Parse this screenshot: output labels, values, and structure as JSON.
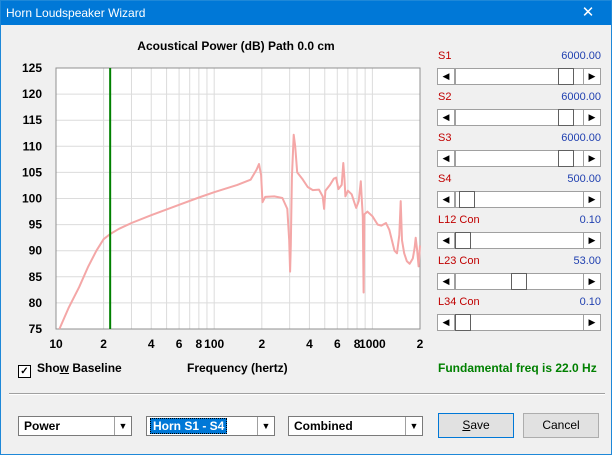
{
  "window": {
    "title": "Horn Loudspeaker Wizard",
    "close_glyph": "✕"
  },
  "chart_data": {
    "type": "line",
    "title": "Acoustical Power (dB)   Path 0.0 cm",
    "xlabel": "Frequency (hertz)",
    "ylabel": "",
    "x_scale": "log",
    "xlim": [
      10,
      2000
    ],
    "ylim": [
      75,
      125
    ],
    "y_ticks": [
      75,
      80,
      85,
      90,
      95,
      100,
      105,
      110,
      115,
      120,
      125
    ],
    "x_tick_labels": [
      {
        "x": 10,
        "label": "10"
      },
      {
        "x": 20,
        "label": "2"
      },
      {
        "x": 40,
        "label": "4"
      },
      {
        "x": 60,
        "label": "6"
      },
      {
        "x": 80,
        "label": "8"
      },
      {
        "x": 100,
        "label": "100"
      },
      {
        "x": 200,
        "label": "2"
      },
      {
        "x": 400,
        "label": "4"
      },
      {
        "x": 600,
        "label": "6"
      },
      {
        "x": 800,
        "label": "8"
      },
      {
        "x": 1000,
        "label": "1000"
      },
      {
        "x": 2000,
        "label": "2"
      }
    ],
    "grid": true,
    "baseline_marker": {
      "x": 22.0,
      "color": "#008000"
    },
    "series": [
      {
        "color": "#f4a7a7",
        "points": [
          [
            10.5,
            75
          ],
          [
            12,
            79
          ],
          [
            14,
            83
          ],
          [
            16,
            87
          ],
          [
            18,
            90
          ],
          [
            20,
            92.2
          ],
          [
            22,
            93.2
          ],
          [
            25,
            94.2
          ],
          [
            30,
            95.3
          ],
          [
            40,
            96.8
          ],
          [
            60,
            98.8
          ],
          [
            80,
            100.2
          ],
          [
            100,
            101.2
          ],
          [
            140,
            102.6
          ],
          [
            170,
            103.6
          ],
          [
            185,
            105.5
          ],
          [
            192,
            106.6
          ],
          [
            198,
            104.5
          ],
          [
            202,
            99.3
          ],
          [
            210,
            100.3
          ],
          [
            240,
            100.4
          ],
          [
            270,
            100.1
          ],
          [
            290,
            98
          ],
          [
            298,
            92
          ],
          [
            302,
            86
          ],
          [
            305,
            91
          ],
          [
            310,
            104
          ],
          [
            318,
            112.2
          ],
          [
            325,
            110
          ],
          [
            335,
            105
          ],
          [
            360,
            103.8
          ],
          [
            390,
            102.2
          ],
          [
            420,
            101.6
          ],
          [
            460,
            101.7
          ],
          [
            485,
            100.4
          ],
          [
            495,
            98
          ],
          [
            505,
            101.5
          ],
          [
            540,
            102.6
          ],
          [
            570,
            103.8
          ],
          [
            590,
            104
          ],
          [
            610,
            101.8
          ],
          [
            640,
            102.6
          ],
          [
            655,
            106.8
          ],
          [
            665,
            104
          ],
          [
            675,
            100.4
          ],
          [
            700,
            101.5
          ],
          [
            740,
            100.8
          ],
          [
            770,
            99.2
          ],
          [
            790,
            98.2
          ],
          [
            820,
            99.5
          ],
          [
            845,
            103.3
          ],
          [
            855,
            100.5
          ],
          [
            870,
            96.5
          ],
          [
            880,
            82
          ],
          [
            890,
            97
          ],
          [
            930,
            97.5
          ],
          [
            1000,
            96.6
          ],
          [
            1080,
            95
          ],
          [
            1140,
            94.8
          ],
          [
            1220,
            95.3
          ],
          [
            1280,
            94
          ],
          [
            1380,
            90
          ],
          [
            1430,
            89.5
          ],
          [
            1480,
            93
          ],
          [
            1510,
            99.5
          ],
          [
            1540,
            92
          ],
          [
            1590,
            89.5
          ],
          [
            1650,
            88
          ],
          [
            1720,
            87.5
          ],
          [
            1800,
            88.5
          ],
          [
            1850,
            90.5
          ],
          [
            1880,
            92.5
          ],
          [
            1920,
            90
          ],
          [
            1960,
            87
          ],
          [
            2000,
            91
          ]
        ]
      }
    ]
  },
  "sliders": [
    {
      "name": "S1",
      "value": "6000.00",
      "position": 0.92
    },
    {
      "name": "S2",
      "value": "6000.00",
      "position": 0.92
    },
    {
      "name": "S3",
      "value": "6000.00",
      "position": 0.92
    },
    {
      "name": "S4",
      "value": "500.00",
      "position": 0.04
    },
    {
      "name": "L12  Con",
      "value": "0.10",
      "position": 0.0
    },
    {
      "name": "L23  Con",
      "value": "53.00",
      "position": 0.5
    },
    {
      "name": "L34  Con",
      "value": "0.10",
      "position": 0.0
    }
  ],
  "show_baseline": {
    "checked_glyph": "✓",
    "label_before": "Sho",
    "label_accel": "w",
    "label_after": " Baseline"
  },
  "fundamental": "Fundamental freq is 22.0 Hz",
  "dropdowns": {
    "measure": "Power",
    "horn": "Horn S1 - S4",
    "mode": "Combined",
    "arrow": "▼"
  },
  "buttons": {
    "save_accel": "S",
    "save_rest": "ave",
    "cancel": "Cancel"
  },
  "slider_arrows": {
    "left": "◀",
    "right": "▶"
  }
}
